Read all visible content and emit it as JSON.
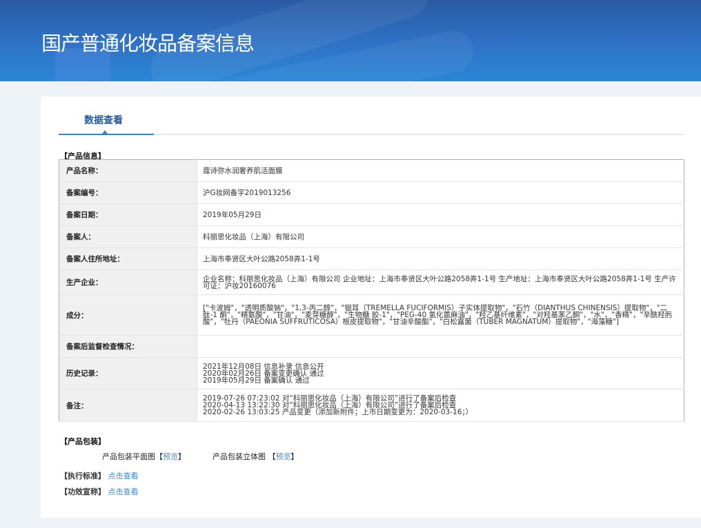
{
  "header": {
    "title": "国产普通化妆品备案信息"
  },
  "tab": {
    "label": "数据查看"
  },
  "product_info": {
    "section_label": "【产品信息】",
    "rows": [
      {
        "label": "产品名称：",
        "value": "蔻诗弥水润奢养肌活面膜"
      },
      {
        "label": "备案编号：",
        "value": "沪G妆网备字2019013256"
      },
      {
        "label": "备案日期：",
        "value": "2019年05月29日"
      },
      {
        "label": "备案人：",
        "value": "科丽思化妆品（上海）有限公司"
      },
      {
        "label": "备案人住所地址：",
        "value": "上海市奉贤区大叶公路2058弄1-1号"
      },
      {
        "label": "生产企业：",
        "value": "企业名称：科丽思化妆品（上海）有限公司 企业地址：上海市奉贤区大叶公路2058弄1-1号 生产地址：上海市奉贤区大叶公路2058弄1-1号 生产许可证：沪妆20160076"
      },
      {
        "label": "成分：",
        "value": "[\"卡波姆\"，\"透明质酸钠\"，\"1,3-丙二醇\"，\"银耳（TREMELLA FUCIFORMIS）子实体提取物\"，\"石竹（DIANTHUS CHINENSIS）提取物\"，\"二肽-1 酮\"，\"精氨酸\"，\"甘油\"，\"麦芽糖醇\"，\"生物糖 胶-1\"，\"PEG-40 氢化蓖麻油\"，\"羟乙基纤维素\"，\"对羟基苯乙酮\"，\"水\"，\"香精\"，\"辛酰羟肟酸\"，\"牡丹（PAEONIA SUFFRUTICOSA）根皮提取物\"，\"甘油辛酸酯\"，\"白松露菌（TUBER MAGNATUM）提取物\"，\"海藻糖\"]"
      },
      {
        "label": "备案后监督检查情况：",
        "value": ""
      }
    ],
    "history": {
      "label": "历史记录：",
      "lines": [
        "2021年12月08日 信息补录 信息公开",
        "2020年02月26日 备案变更确认 通过",
        "2019年05月29日 备案确认 通过"
      ]
    },
    "notes": {
      "label": "备注：",
      "lines": [
        "2019-07-26 07:23:02 对“科丽思化妆品（上海）有限公司”进行了备案后检查",
        "2020-04-13 13:22:30 对“科丽思化妆品（上海）有限公司”进行了备案后检查",
        "2020-02-26 13:03:25 产品变更（添加新附件；上市日期变更为：2020-03-16；）"
      ]
    }
  },
  "packaging": {
    "section_label": "【产品包装】",
    "flat_label": "产品包装平面图【",
    "flat_link": "预览",
    "flat_end": "】",
    "solid_label": "产品包装立体图 【",
    "solid_link": "预览",
    "solid_end": "】"
  },
  "standard": {
    "label": "【执行标准】",
    "link": "点击查看"
  },
  "efficacy": {
    "label": "【功效宣称】",
    "link": "点击查看"
  }
}
